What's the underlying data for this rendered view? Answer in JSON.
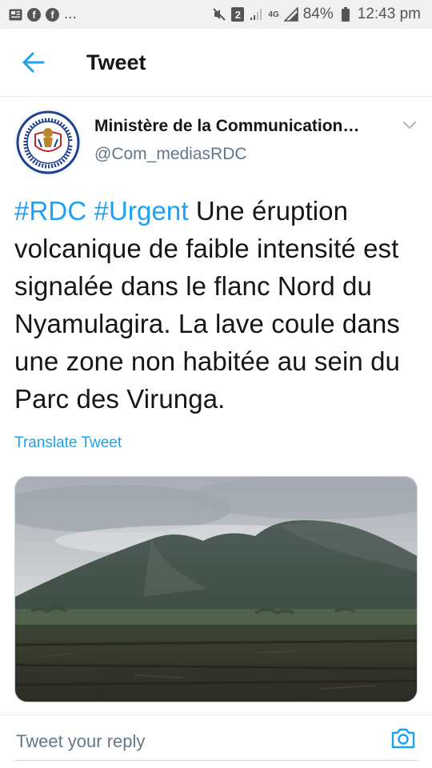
{
  "status_bar": {
    "dots": "...",
    "badge": "2",
    "network": "4G",
    "battery": "84%",
    "time": "12:43 pm"
  },
  "header": {
    "title": "Tweet"
  },
  "tweet": {
    "author_name": "Ministère de la Communication…",
    "author_handle": "@Com_mediasRDC",
    "hashtags": [
      "#RDC",
      "#Urgent"
    ],
    "body": "Une éruption volcanique de faible intensité est signalée dans le flanc Nord du Nyamulagira. La lave coule dans une zone non habitée au sein du Parc des Virunga.",
    "translate_label": "Translate Tweet"
  },
  "reply": {
    "placeholder": "Tweet your reply"
  },
  "colors": {
    "accent": "#1da1f2",
    "text": "#14171a",
    "secondary": "#657786"
  }
}
